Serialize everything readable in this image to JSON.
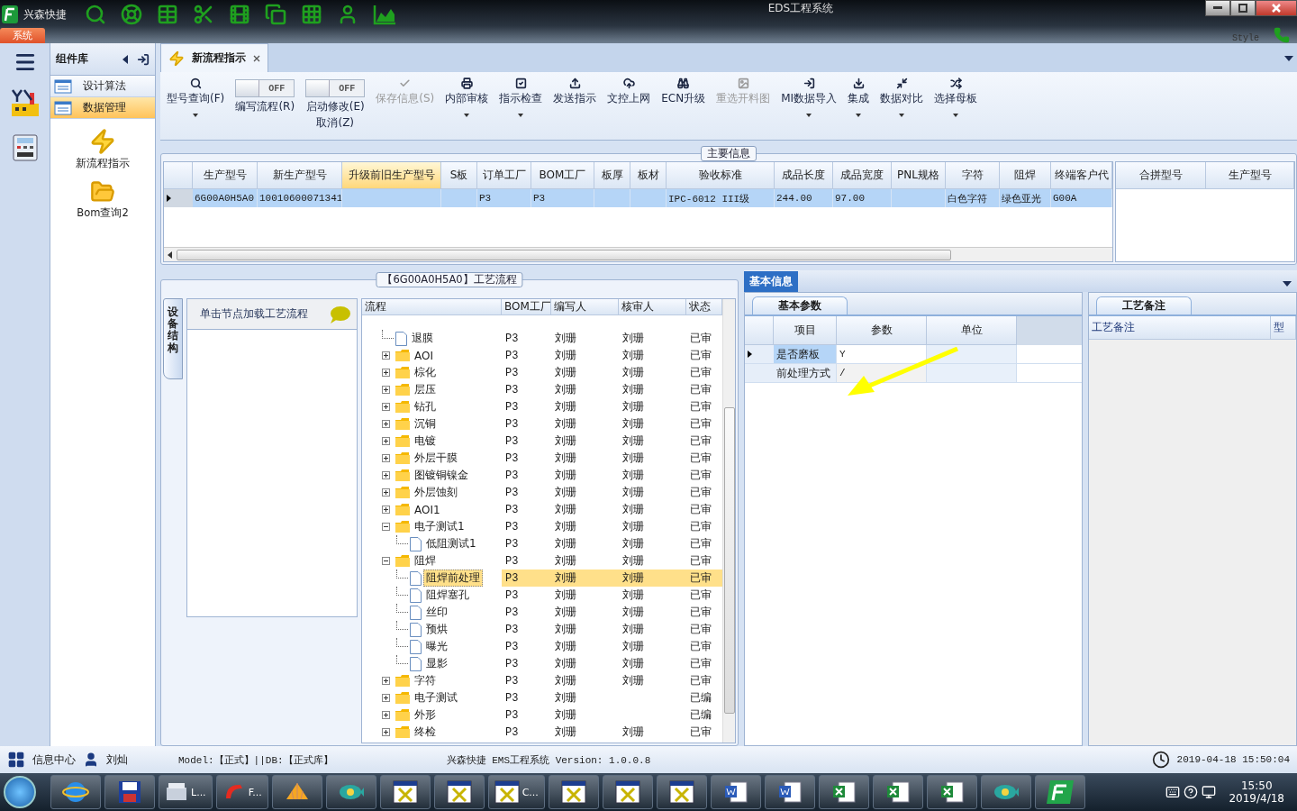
{
  "titlebar": {
    "app_name": "兴森快捷",
    "title": "EDS工程系统",
    "menu_tab": "系统",
    "style_label": "Style"
  },
  "component_panel": {
    "title": "组件库",
    "items": [
      {
        "label": "设计算法",
        "selected": false
      },
      {
        "label": "数据管理",
        "selected": true
      }
    ],
    "tools": [
      "新流程指示",
      "Bom查询2"
    ]
  },
  "doc_tab": {
    "label": "新流程指示"
  },
  "toolbar": [
    {
      "kind": "button",
      "lines": [
        "型号查询(F)"
      ],
      "dropdown": true,
      "disabled": false
    },
    {
      "kind": "toggle",
      "lines": [
        "编写流程(R)"
      ],
      "state": "OFF",
      "on": false
    },
    {
      "kind": "toggle",
      "lines": [
        "启动修改(E)",
        "取消(Z)"
      ],
      "state": "OFF",
      "on": false
    },
    {
      "kind": "button",
      "lines": [
        "保存信息(S)"
      ],
      "dropdown": false,
      "disabled": true
    },
    {
      "kind": "button",
      "lines": [
        "内部审核"
      ],
      "dropdown": true,
      "disabled": false
    },
    {
      "kind": "button",
      "lines": [
        "指示检查"
      ],
      "dropdown": true,
      "disabled": false
    },
    {
      "kind": "button",
      "lines": [
        "发送指示"
      ],
      "dropdown": false,
      "disabled": false
    },
    {
      "kind": "button",
      "lines": [
        "文控上网"
      ],
      "dropdown": false,
      "disabled": false
    },
    {
      "kind": "button",
      "lines": [
        "ECN升级"
      ],
      "dropdown": false,
      "disabled": false
    },
    {
      "kind": "button",
      "lines": [
        "重选开料图"
      ],
      "dropdown": false,
      "disabled": true
    },
    {
      "kind": "button",
      "lines": [
        "MI数据导入"
      ],
      "dropdown": true,
      "disabled": false
    },
    {
      "kind": "button",
      "lines": [
        "集成"
      ],
      "dropdown": true,
      "disabled": false
    },
    {
      "kind": "button",
      "lines": [
        "数据对比"
      ],
      "dropdown": true,
      "disabled": false
    },
    {
      "kind": "button",
      "lines": [
        "选择母板"
      ],
      "dropdown": true,
      "disabled": false
    }
  ],
  "main_info": {
    "title": "主要信息",
    "columns": [
      {
        "label": "生产型号",
        "highlighted": false
      },
      {
        "label": "新生产型号",
        "highlighted": false
      },
      {
        "label": "升级前旧生产型号",
        "highlighted": true
      },
      {
        "label": "S板",
        "highlighted": false
      },
      {
        "label": "订单工厂",
        "highlighted": false
      },
      {
        "label": "BOM工厂",
        "highlighted": false
      },
      {
        "label": "板厚",
        "highlighted": false
      },
      {
        "label": "板材",
        "highlighted": false
      },
      {
        "label": "验收标准",
        "highlighted": false
      },
      {
        "label": "成品长度",
        "highlighted": false
      },
      {
        "label": "成品宽度",
        "highlighted": false
      },
      {
        "label": "PNL规格",
        "highlighted": false
      },
      {
        "label": "字符",
        "highlighted": false
      },
      {
        "label": "阻焊",
        "highlighted": false
      },
      {
        "label": "终端客户代",
        "highlighted": false
      }
    ],
    "rows": [
      {
        "selected": true,
        "cells": [
          "6G00A0H5A0",
          "10010600071341",
          null,
          null,
          "P3",
          "P3",
          null,
          null,
          "IPC-6012 III级",
          "244.00",
          "97.00",
          null,
          "白色字符",
          "绿色亚光",
          "G00A"
        ]
      }
    ],
    "side_columns": [
      "合拼型号",
      "生产型号"
    ]
  },
  "process": {
    "title": "【6G00A0H5A0】工艺流程",
    "side_tab": "设备结构",
    "hint": "单击节点加载工艺流程",
    "columns": [
      "流程",
      "BOM工厂",
      "编写人",
      "核审人",
      "状态"
    ],
    "tree": [
      {
        "label": "退膜",
        "kind": "file",
        "factory": "P3",
        "author": "刘珊",
        "reviewer": "刘珊",
        "status": "已审",
        "selected": false
      },
      {
        "label": "AOI",
        "kind": "folder",
        "expanded": false,
        "factory": "P3",
        "author": "刘珊",
        "reviewer": "刘珊",
        "status": "已审",
        "selected": false
      },
      {
        "label": "棕化",
        "kind": "folder",
        "expanded": false,
        "factory": "P3",
        "author": "刘珊",
        "reviewer": "刘珊",
        "status": "已审",
        "selected": false
      },
      {
        "label": "层压",
        "kind": "folder",
        "expanded": false,
        "factory": "P3",
        "author": "刘珊",
        "reviewer": "刘珊",
        "status": "已审",
        "selected": false
      },
      {
        "label": "钻孔",
        "kind": "folder",
        "expanded": false,
        "factory": "P3",
        "author": "刘珊",
        "reviewer": "刘珊",
        "status": "已审",
        "selected": false
      },
      {
        "label": "沉铜",
        "kind": "folder",
        "expanded": false,
        "factory": "P3",
        "author": "刘珊",
        "reviewer": "刘珊",
        "status": "已审",
        "selected": false
      },
      {
        "label": "电镀",
        "kind": "folder",
        "expanded": false,
        "factory": "P3",
        "author": "刘珊",
        "reviewer": "刘珊",
        "status": "已审",
        "selected": false
      },
      {
        "label": "外层干膜",
        "kind": "folder",
        "expanded": false,
        "factory": "P3",
        "author": "刘珊",
        "reviewer": "刘珊",
        "status": "已审",
        "selected": false
      },
      {
        "label": "图镀铜镍金",
        "kind": "folder",
        "expanded": false,
        "factory": "P3",
        "author": "刘珊",
        "reviewer": "刘珊",
        "status": "已审",
        "selected": false
      },
      {
        "label": "外层蚀刻",
        "kind": "folder",
        "expanded": false,
        "factory": "P3",
        "author": "刘珊",
        "reviewer": "刘珊",
        "status": "已审",
        "selected": false
      },
      {
        "label": "AOI1",
        "kind": "folder",
        "expanded": false,
        "factory": "P3",
        "author": "刘珊",
        "reviewer": "刘珊",
        "status": "已审",
        "selected": false
      },
      {
        "label": "电子测试1",
        "kind": "folder",
        "expanded": true,
        "factory": "P3",
        "author": "刘珊",
        "reviewer": "刘珊",
        "status": "已审",
        "selected": false,
        "children": [
          {
            "label": "低阻测试1",
            "kind": "file",
            "factory": "P3",
            "author": "刘珊",
            "reviewer": "刘珊",
            "status": "已审",
            "selected": false
          }
        ]
      },
      {
        "label": "阻焊",
        "kind": "folder",
        "expanded": true,
        "factory": "P3",
        "author": "刘珊",
        "reviewer": "刘珊",
        "status": "已审",
        "selected": false,
        "children": [
          {
            "label": "阻焊前处理",
            "kind": "file",
            "factory": "P3",
            "author": "刘珊",
            "reviewer": "刘珊",
            "status": "已审",
            "selected": true
          },
          {
            "label": "阻焊塞孔",
            "kind": "file",
            "factory": "P3",
            "author": "刘珊",
            "reviewer": "刘珊",
            "status": "已审",
            "selected": false
          },
          {
            "label": "丝印",
            "kind": "file",
            "factory": "P3",
            "author": "刘珊",
            "reviewer": "刘珊",
            "status": "已审",
            "selected": false
          },
          {
            "label": "预烘",
            "kind": "file",
            "factory": "P3",
            "author": "刘珊",
            "reviewer": "刘珊",
            "status": "已审",
            "selected": false
          },
          {
            "label": "曝光",
            "kind": "file",
            "factory": "P3",
            "author": "刘珊",
            "reviewer": "刘珊",
            "status": "已审",
            "selected": false
          },
          {
            "label": "显影",
            "kind": "file",
            "factory": "P3",
            "author": "刘珊",
            "reviewer": "刘珊",
            "status": "已审",
            "selected": false
          }
        ]
      },
      {
        "label": "字符",
        "kind": "folder",
        "expanded": false,
        "factory": "P3",
        "author": "刘珊",
        "reviewer": "刘珊",
        "status": "已审",
        "selected": false
      },
      {
        "label": "电子测试",
        "kind": "folder",
        "expanded": false,
        "factory": "P3",
        "author": "刘珊",
        "status": "已编",
        "selected": false
      },
      {
        "label": "外形",
        "kind": "folder",
        "expanded": false,
        "factory": "P3",
        "author": "刘珊",
        "status": "已编",
        "selected": false
      },
      {
        "label": "终检",
        "kind": "folder",
        "expanded": false,
        "factory": "P3",
        "author": "刘珊",
        "reviewer": "刘珊",
        "status": "已审",
        "selected": false
      }
    ]
  },
  "basic_info": {
    "title": "基本信息",
    "params_tab": "基本参数",
    "columns": [
      "项目",
      "参数",
      "单位"
    ],
    "rows": [
      {
        "item": "是否磨板",
        "value": "Y",
        "selected": true
      },
      {
        "item": "前处理方式",
        "value": "/",
        "selected": false
      }
    ],
    "remarks_tab": "工艺备注",
    "remarks_columns": [
      "工艺备注",
      "型"
    ]
  },
  "status_bar": {
    "info_center": "信息中心",
    "user": "刘灿",
    "model": "Model:【正式】||DB:【正式库】",
    "version": "兴森快捷 EMS工程系统 Version: 1.0.0.8",
    "datetime": "2019-04-18 15:50:04"
  },
  "taskbar": {
    "items": [
      {
        "kind": "browser"
      },
      {
        "kind": "save"
      },
      {
        "kind": "scanner",
        "label": "L..."
      },
      {
        "kind": "flash",
        "label": "F..."
      },
      {
        "kind": "shell"
      },
      {
        "kind": "fish"
      },
      {
        "kind": "window"
      },
      {
        "kind": "window"
      },
      {
        "kind": "window",
        "label": "C..."
      },
      {
        "kind": "window"
      },
      {
        "kind": "window"
      },
      {
        "kind": "window"
      },
      {
        "kind": "word"
      },
      {
        "kind": "word"
      },
      {
        "kind": "excel"
      },
      {
        "kind": "excel"
      },
      {
        "kind": "excel"
      },
      {
        "kind": "fish"
      },
      {
        "kind": "fapp"
      }
    ],
    "time": "15:50",
    "date": "2019/4/18"
  }
}
